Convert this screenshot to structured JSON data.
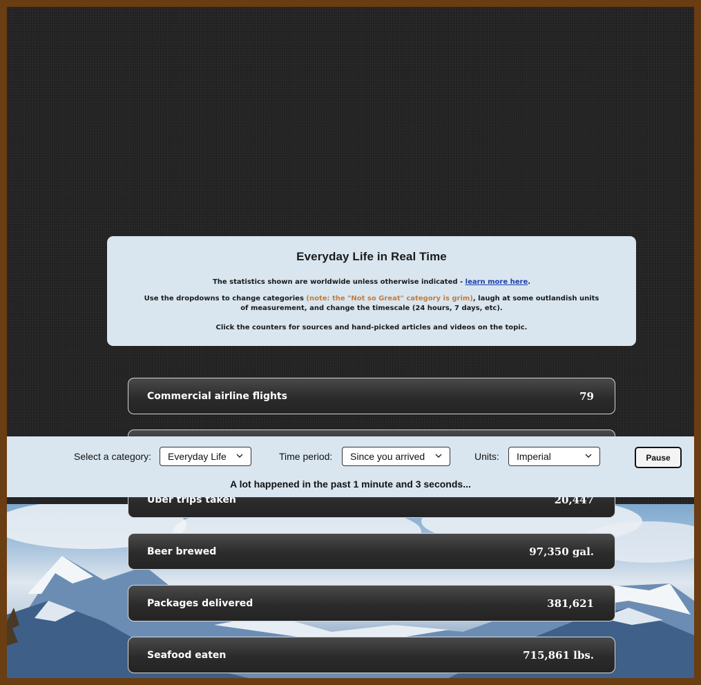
{
  "intro": {
    "title": "Everyday Life in Real Time",
    "p1_text": "The statistics shown are worldwide unless otherwise indicated - ",
    "p1_link": "learn more here",
    "p1_end": ".",
    "p2_start": "Use the dropdowns to change categories ",
    "p2_warn": "(note: the \"Not so Great\" category is grim)",
    "p2_end": ", laugh at some outlandish units of measurement, and change the timescale (24 hours, 7 days, etc).",
    "p3_text": "Click the counters for sources and hand-picked articles and videos on the topic."
  },
  "counters": [
    {
      "label": "Commercial airline flights",
      "value": "79"
    },
    {
      "label": "",
      "value": ""
    },
    {
      "label": "Uber trips taken",
      "value": "20,447"
    },
    {
      "label": "Beer brewed",
      "value": "97,350 gal."
    },
    {
      "label": "Packages delivered",
      "value": "381,621"
    },
    {
      "label": "Seafood eaten",
      "value": "715,861 lbs."
    }
  ],
  "controls": {
    "category_label": "Select a category:",
    "category_value": "Everyday Life",
    "time_label": "Time period:",
    "time_value": "Since you arrived",
    "units_label": "Units:",
    "units_value": "Imperial",
    "pause_label": "Pause",
    "status_text": "A lot happened in the past 1 minute and 3 seconds..."
  },
  "icons": {
    "dropdown": "chevron-down-icon"
  },
  "colors": {
    "frame": "#6b3d12",
    "panel": "#d9e6f0",
    "warning_text": "#c47a3a",
    "link": "#1a3fb0"
  }
}
